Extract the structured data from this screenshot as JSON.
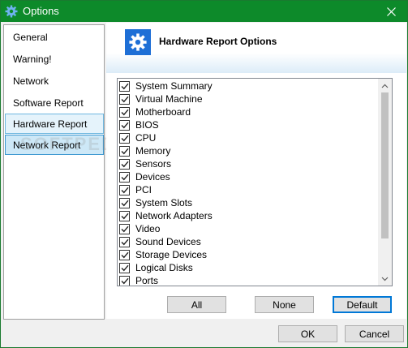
{
  "window": {
    "title": "Options"
  },
  "sidebar": {
    "items": [
      {
        "label": "General"
      },
      {
        "label": "Warning!"
      },
      {
        "label": "Network"
      },
      {
        "label": "Software Report"
      },
      {
        "label": "Hardware Report"
      },
      {
        "label": "Network Report"
      }
    ]
  },
  "header": {
    "title": "Hardware Report Options",
    "icon": "gear-icon"
  },
  "list": {
    "items": [
      {
        "label": "System Summary",
        "checked": true
      },
      {
        "label": "Virtual Machine",
        "checked": true
      },
      {
        "label": "Motherboard",
        "checked": true
      },
      {
        "label": "BIOS",
        "checked": true
      },
      {
        "label": "CPU",
        "checked": true
      },
      {
        "label": "Memory",
        "checked": true
      },
      {
        "label": "Sensors",
        "checked": true
      },
      {
        "label": "Devices",
        "checked": true
      },
      {
        "label": "PCI",
        "checked": true
      },
      {
        "label": "System Slots",
        "checked": true
      },
      {
        "label": "Network Adapters",
        "checked": true
      },
      {
        "label": "Video",
        "checked": true
      },
      {
        "label": "Sound Devices",
        "checked": true
      },
      {
        "label": "Storage Devices",
        "checked": true
      },
      {
        "label": "Logical Disks",
        "checked": true
      },
      {
        "label": "Ports",
        "checked": true
      }
    ]
  },
  "buttons": {
    "all": "All",
    "none": "None",
    "default": "Default",
    "ok": "OK",
    "cancel": "Cancel"
  },
  "watermark": "SOFTPEDIA",
  "colors": {
    "titlebar": "#0d8a2a",
    "accent": "#1e6fd6",
    "selection": "#cde8f7"
  }
}
